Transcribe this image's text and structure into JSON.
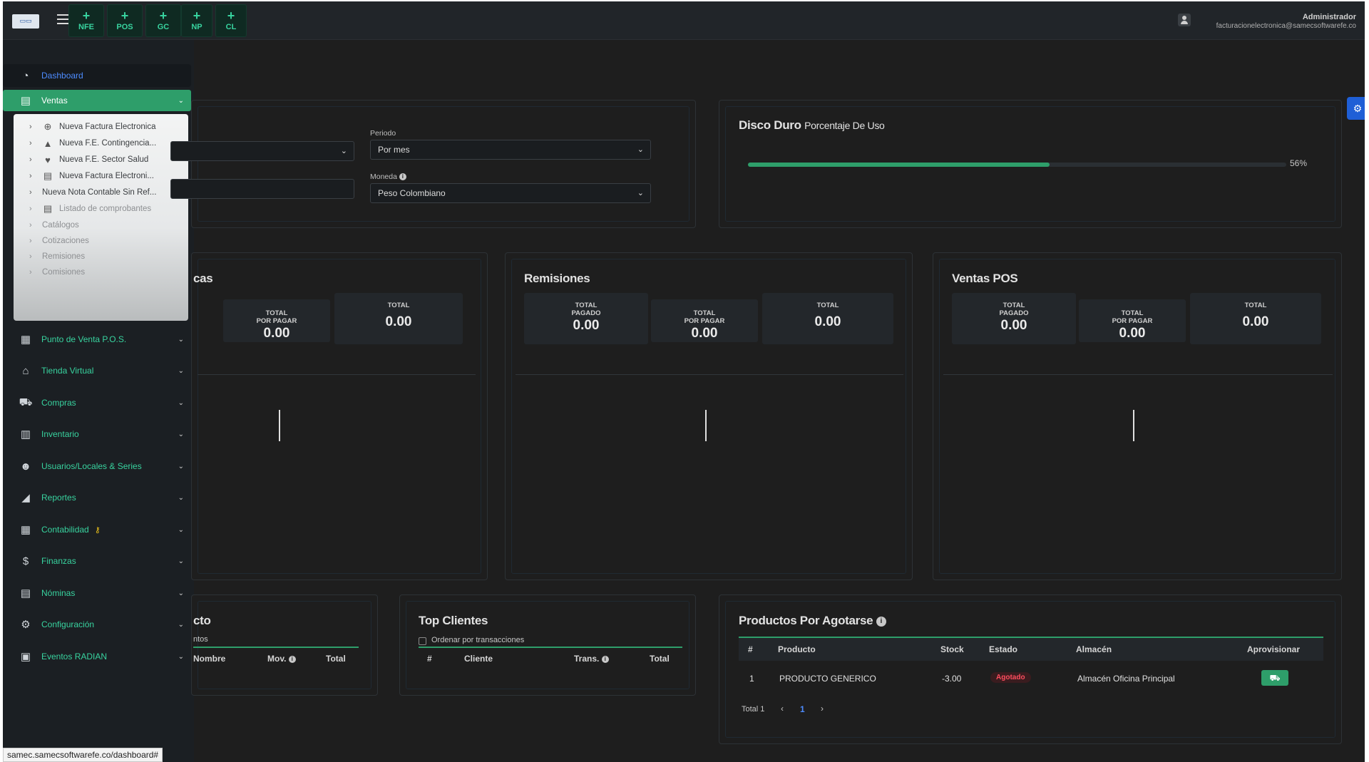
{
  "topbar": {
    "quick_buttons": [
      {
        "label": "NFE"
      },
      {
        "label": "POS"
      },
      {
        "label": "GC"
      },
      {
        "label": "NP"
      },
      {
        "label": "CL"
      }
    ],
    "user_name": "Administrador",
    "user_email": "facturacionelectronica@samecsoftwarefe.co"
  },
  "sidebar": {
    "dashboard": "Dashboard",
    "ventas": "Ventas",
    "ventas_sub": [
      {
        "label": "Nueva Factura Electronica",
        "icon": "plus-circle-icon"
      },
      {
        "label": "Nueva F.E. Contingencia...",
        "icon": "warning-icon"
      },
      {
        "label": "Nueva F.E. Sector Salud",
        "icon": "heart-icon"
      },
      {
        "label": "Nueva Factura Electroni...",
        "icon": "document-icon"
      },
      {
        "label": "Nueva Nota Contable Sin Ref...",
        "icon": ""
      },
      {
        "label": "Listado de comprobantes",
        "icon": "document-list-icon"
      },
      {
        "label": "Catálogos",
        "icon": ""
      },
      {
        "label": "Cotizaciones",
        "icon": ""
      },
      {
        "label": "Remisiones",
        "icon": ""
      },
      {
        "label": "Comisiones",
        "icon": ""
      }
    ],
    "items": [
      {
        "label": "Punto de Venta P.O.S.",
        "icon": "cash-register-icon"
      },
      {
        "label": "Tienda Virtual",
        "icon": "store-icon"
      },
      {
        "label": "Compras",
        "icon": "cart-icon"
      },
      {
        "label": "Inventario",
        "icon": "warehouse-icon"
      },
      {
        "label": "Usuarios/Locales & Series",
        "icon": "users-icon"
      },
      {
        "label": "Reportes",
        "icon": "chart-area-icon"
      },
      {
        "label": "Contabilidad",
        "icon": "calculator-icon"
      },
      {
        "label": "Finanzas",
        "icon": "hand-money-icon"
      },
      {
        "label": "Nóminas",
        "icon": "clipboard-icon"
      },
      {
        "label": "Configuración",
        "icon": "gears-icon"
      },
      {
        "label": "Eventos RADIAN",
        "icon": "calendar-check-icon"
      }
    ]
  },
  "filters": {
    "periodo_label": "Periodo",
    "periodo_value": "Por mes",
    "moneda_label": "Moneda",
    "moneda_value": "Peso Colombiano"
  },
  "disk": {
    "title": "Disco Duro",
    "subtitle": "Porcentaje De Uso",
    "percent_text": "56%",
    "percent": 0.56
  },
  "cards": {
    "facturas": {
      "title": "cas",
      "por_pagar_label_1": "TOTAL",
      "por_pagar_label_2": "POR PAGAR",
      "por_pagar_value": "0.00",
      "total_label": "TOTAL",
      "total_value": "0.00"
    },
    "remisiones": {
      "title": "Remisiones",
      "pagado_label_1": "TOTAL",
      "pagado_label_2": "PAGADO",
      "pagado_value": "0.00",
      "por_pagar_label_1": "TOTAL",
      "por_pagar_label_2": "POR PAGAR",
      "por_pagar_value": "0.00",
      "total_label": "TOTAL",
      "total_value": "0.00"
    },
    "ventas_pos": {
      "title": "Ventas POS",
      "pagado_label_1": "TOTAL",
      "pagado_label_2": "PAGADO",
      "pagado_value": "0.00",
      "por_pagar_label_1": "TOTAL",
      "por_pagar_label_2": "POR PAGAR",
      "por_pagar_value": "0.00",
      "total_label": "TOTAL",
      "total_value": "0.00"
    }
  },
  "top_producto": {
    "title": "cto",
    "sub_label": "ntos",
    "headers": [
      "Nombre",
      "Mov.",
      "Total"
    ]
  },
  "top_clientes": {
    "title": "Top Clientes",
    "checkbox_label": "Ordenar por transacciones",
    "headers": [
      "#",
      "Cliente",
      "Trans.",
      "Total"
    ]
  },
  "productos_agotarse": {
    "title": "Productos Por Agotarse",
    "headers": [
      "#",
      "Producto",
      "Stock",
      "Estado",
      "Almacén",
      "Aprovisionar"
    ],
    "rows": [
      {
        "num": "1",
        "producto": "PRODUCTO GENERICO",
        "stock": "-3.00",
        "estado": "Agotado",
        "almacen": "Almacén Oficina Principal"
      }
    ],
    "total_text": "Total 1",
    "page": "1"
  },
  "status_url": "samec.samecsoftwarefe.co/dashboard#"
}
